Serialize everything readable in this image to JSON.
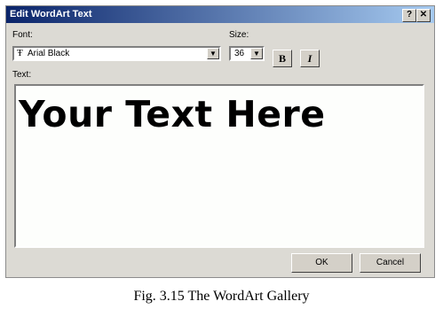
{
  "dialog": {
    "title": "Edit WordArt Text",
    "help_button": "?",
    "close_button": "✕",
    "font_label": "Font:",
    "font_value": "Arial Black",
    "font_icon_glyph": "Ŧ",
    "size_label": "Size:",
    "size_value": "36",
    "bold_label": "B",
    "italic_label": "I",
    "text_label": "Text:",
    "text_value": "Your Text Here",
    "ok_label": "OK",
    "cancel_label": "Cancel",
    "dropdown_arrow": "▼"
  },
  "caption": "Fig. 3.15 The WordArt Gallery"
}
